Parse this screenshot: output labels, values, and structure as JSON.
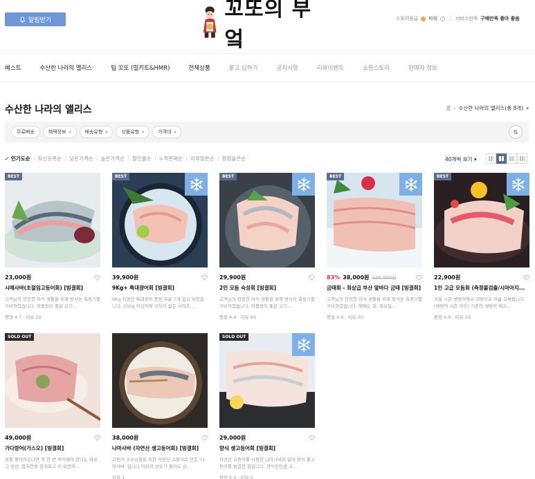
{
  "header": {
    "alarm_button": "알림받기",
    "logo_text": "꼬또의 부엌",
    "store_grade_label": "스토어등급",
    "store_grade_value": "파워",
    "service_label": "서비스만족",
    "service_value": "구매만족 좋아 좋음"
  },
  "nav": {
    "items": [
      {
        "label": "베스트",
        "dim": false
      },
      {
        "label": "수산한 나라의 앨리스",
        "dim": false
      },
      {
        "label": "팀 꼬또 (밀키트&HMR)",
        "dim": false
      },
      {
        "label": "전체상품",
        "dim": false
      },
      {
        "label": "묻고 답하기",
        "dim": true
      },
      {
        "label": "공지사항",
        "dim": true
      },
      {
        "label": "리뷰이벤트",
        "dim": true
      },
      {
        "label": "쇼핑스토리",
        "dim": true
      },
      {
        "label": "판매자 정보",
        "dim": true
      }
    ]
  },
  "page": {
    "title": "수산한 나라의 앨리스",
    "breadcrumb_home": "홈",
    "breadcrumb_current": "수산한 나라의 앨리스(총 8개)"
  },
  "filters": [
    "무료배송",
    "혜택정보",
    "배송유형",
    "상품유형",
    "가격대"
  ],
  "sorts": [
    "인기도순",
    "최신등록순",
    "낮은가격순",
    "높은가격순",
    "할인율순",
    "누적판매순",
    "리뷰많은순",
    "평점높은순"
  ],
  "per_page": "40개씩 보기",
  "accent_color": "#5b6c8e",
  "snow_color": "#7eb0e6",
  "products": [
    {
      "badge": "BEST",
      "price": "23,000원",
      "discount": "",
      "orig": "",
      "name": "시메사바(초절임고등어회) [빙결회]",
      "desc": "고객님의 안전한 미식 생활을 위해 방사능 측정기를 구비하였습니다. 마블링이 좋은 고기...",
      "meta": "평점 4.7 · 리뷰 20"
    },
    {
      "badge": "BEST",
      "price": "39,900원",
      "discount": "",
      "orig": "",
      "name": "9Kg+ 특대광어회 [빙결회]",
      "desc": "9Kg 자연산 특대광어 중량 부분 7개 입고 되었습니다. 250g 이상이며 구하기 힘든 사이즈...",
      "meta": ""
    },
    {
      "badge": "BEST",
      "price": "29,900원",
      "discount": "",
      "orig": "",
      "name": "2인 모듬 숙성회 [빙결회]",
      "desc": "고객님의 안전한 미식 생활을 위해 방사능 측정기를 구비하였습니다. 마블링이 좋은 고기...",
      "meta": "평점 4.9 · 리뷰 64"
    },
    {
      "badge": "BEST",
      "price": "38,000원",
      "discount": "83%",
      "orig": "220,000원",
      "name": "금태회 - 최상급 부산 앞바다 금태 [빙결회]",
      "desc": "고객님의 안전한 미식 생활을 위해 방사능 측정기를 구비하였습니다. 택배는 화, 목요일...",
      "meta": "평점 4.6 · 리뷰 20"
    },
    {
      "badge": "BEST",
      "price": "22,900원",
      "discount": "",
      "orig": "",
      "name": "1인 고급 모듬회 (측정불검출/시마아지...",
      "desc": "겨울 시즌 쌧방어에서 대방어로 여름 고체됩니다(쌧방어 시즌 아웃) 기존의 쌧방어 제고...",
      "meta": "평점 4.8 · 리뷰 29"
    },
    {
      "badge": "SOLD OUT",
      "price": "49,000원",
      "discount": "",
      "orig": "",
      "name": "가다랑어(가스오) [빙결회]",
      "desc": "회를 좋아하신다면 꼭 한 번 먹어봐야 한다는 바로 그 생선, 참치한동 참치회고 이 유명하...",
      "meta": ""
    },
    {
      "badge": "",
      "price": "38,000원",
      "discount": "",
      "orig": "",
      "name": "나마사바 (자연산 생고등어회) [빙결회]",
      "desc": "고등어 고수님들을 위한 자연산 고등어로 만든 '나마사바' 입니다 아무리 선도가 좋아도 선...",
      "meta": "리뷰 1"
    },
    {
      "badge": "SOLD OUT",
      "price": "29,000원",
      "discount": "",
      "orig": "",
      "name": "양식 생고등어회 [빙결회]",
      "desc": "자연산 고등어를 사용한 나마사바와 달리 양식 활고등어를 빙결한 회입니다. 양식인만큼 고...",
      "meta": "평점 5.0 · 리뷰 5"
    }
  ]
}
